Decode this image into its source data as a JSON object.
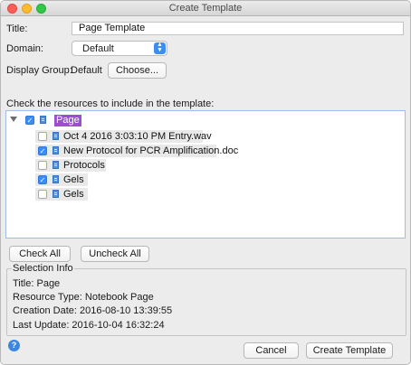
{
  "window": {
    "title": "Create Template"
  },
  "form": {
    "title_label": "Title:",
    "title_value": "Page Template",
    "domain_label": "Domain:",
    "domain_value": "Default",
    "display_group_label": "Display Group:",
    "display_group_value": "Default",
    "choose_label": "Choose..."
  },
  "resources": {
    "heading": "Check the resources to include in the template:",
    "root": {
      "label": "Page",
      "checked": true,
      "expanded": true
    },
    "items": [
      {
        "label": "Oct 4 2016 3:03:10 PM Entry.wav",
        "checked": false
      },
      {
        "label": "New Protocol for PCR Amplification.doc",
        "checked": true
      },
      {
        "label": "Protocols",
        "checked": false
      },
      {
        "label": "Gels",
        "checked": true
      },
      {
        "label": "Gels",
        "checked": false
      }
    ]
  },
  "buttons": {
    "check_all": "Check All",
    "uncheck_all": "Uncheck All",
    "cancel": "Cancel",
    "create": "Create Template"
  },
  "selection_info": {
    "title": "Selection Info",
    "lines": [
      "Title: Page",
      "Resource Type: Notebook Page",
      "Creation Date: 2016-08-10 13:39:55",
      "Last Update: 2016-10-04 16:32:24"
    ]
  },
  "icons": {
    "help": "help-icon",
    "document": "document-icon",
    "check": "checkmark-icon",
    "disclosure": "disclosure-triangle-icon"
  },
  "colors": {
    "accent": "#3d8cf2",
    "selection": "#9a4fd0",
    "close": "#fc5f57",
    "minimize": "#fdbc2e",
    "zoom": "#33c748"
  }
}
